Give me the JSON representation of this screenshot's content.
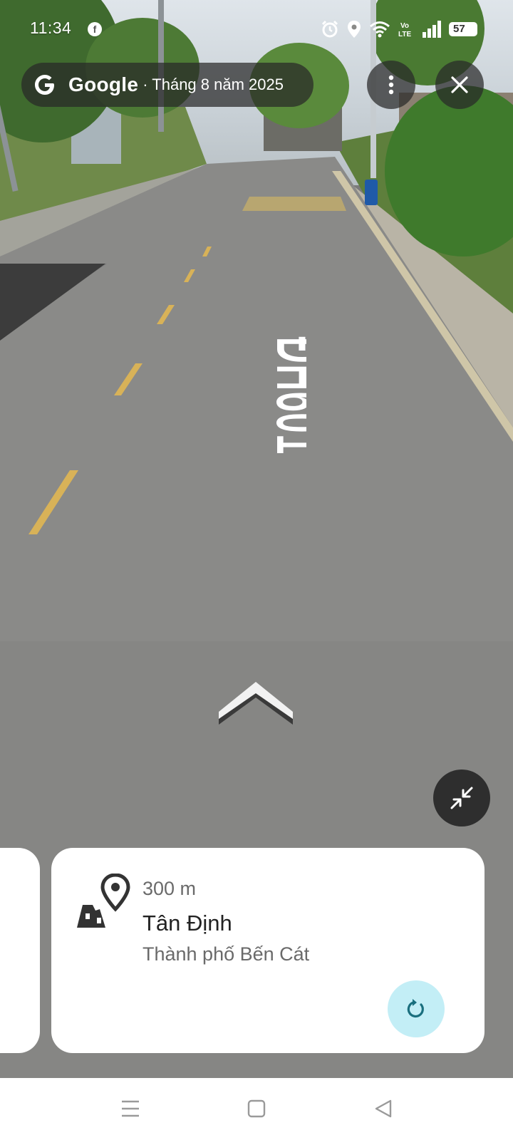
{
  "status_bar": {
    "time": "11:34",
    "notification_icons": [
      "facebook-icon"
    ],
    "system_icons": [
      "alarm-icon",
      "location-icon",
      "wifi-icon",
      "volte-icon",
      "signal-icon",
      "battery-icon"
    ],
    "volte_label_top": "Vo",
    "volte_label_bottom": "LTE",
    "battery_level": "57"
  },
  "header": {
    "brand": "Google",
    "date": "· Tháng 8 năm 2025"
  },
  "scene": {
    "road_marking": "ĐH601"
  },
  "place_card": {
    "distance": "300 m",
    "name": "Tân Định",
    "region": "Thành phố Bến Cát"
  },
  "colors": {
    "header_bg": "#282828",
    "refresh_button_bg": "#c3eef6",
    "refresh_icon": "#1a6f7e",
    "card_bg": "#ffffff"
  },
  "nav_bar": {
    "buttons": [
      "menu-icon",
      "home-icon",
      "back-icon"
    ]
  }
}
